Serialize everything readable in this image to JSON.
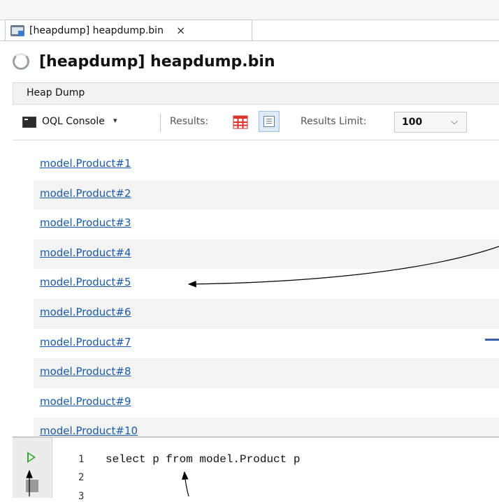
{
  "window": {
    "tab_label": "[heapdump] heapdump.bin",
    "tab_close_glyph": "×",
    "title": "[heapdump] heapdump.bin"
  },
  "subtabs": {
    "items": [
      "Heap Dump"
    ]
  },
  "toolbar": {
    "oql_console_label": "OQL Console",
    "dropdown_glyph": "▾",
    "results_label": "Results:",
    "results_limit_label": "Results Limit:",
    "results_limit_value": "100",
    "select_chevron": "⌵"
  },
  "results": {
    "rows": [
      "model.Product#1",
      "model.Product#2",
      "model.Product#3",
      "model.Product#4",
      "model.Product#5",
      "model.Product#6",
      "model.Product#7",
      "model.Product#8",
      "model.Product#9",
      "model.Product#10"
    ]
  },
  "editor": {
    "line_numbers": [
      "1",
      "2",
      "3"
    ],
    "code": "select p from model.Product p"
  },
  "icons": {
    "tab": "heapdump-file-icon",
    "title": "loading-spinner-icon",
    "oql": "terminal-icon",
    "table_view": "table-view-icon",
    "text_view": "text-view-icon",
    "run": "run-query-icon",
    "stop": "stop-query-icon"
  },
  "colors": {
    "link": "#1a5aa8",
    "run_green": "#3aa135",
    "selected_button_bg": "#dfeaf6",
    "table_icon_red": "#d9342b"
  }
}
